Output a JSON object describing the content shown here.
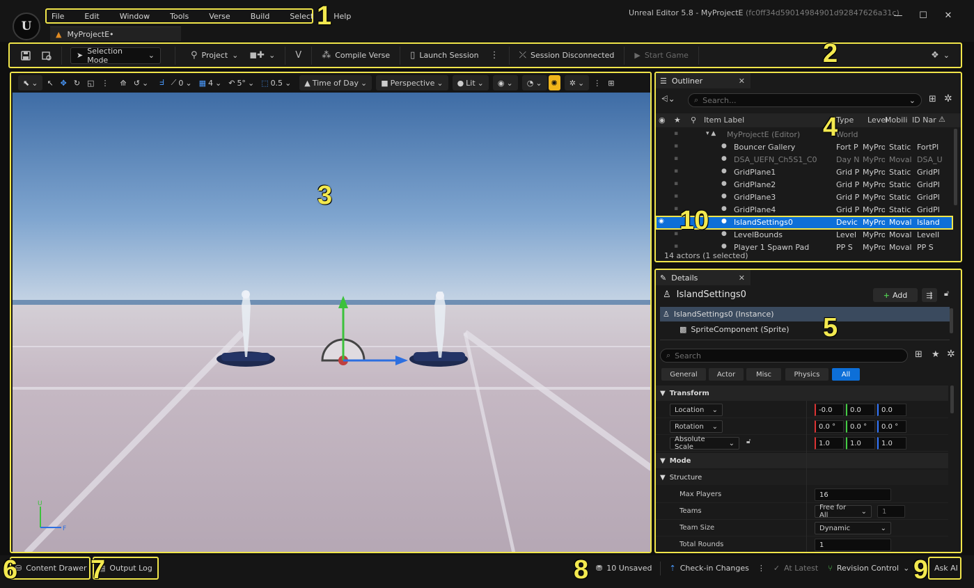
{
  "app": {
    "window_title": "Unreal Editor 5.8 - MyProjectE",
    "window_hash": "(fc0ff34d59014984901d92847626a31c)",
    "document_tab": "MyProjectE•"
  },
  "menu": [
    "File",
    "Edit",
    "Window",
    "Tools",
    "Verse",
    "Build",
    "Select",
    "Help"
  ],
  "toolbar": {
    "selection_mode": "Selection Mode",
    "project": "Project",
    "compile_verse": "Compile Verse",
    "launch_session": "Launch Session",
    "session_status": "Session Disconnected",
    "start_game": "Start Game"
  },
  "viewport": {
    "translate_snap": "0",
    "grid_snap": "4",
    "rotate_snap": "5°",
    "scale_snap": "0.5",
    "time_of_day": "Time of Day",
    "perspective": "Perspective",
    "view_mode": "Lit",
    "axis_x": "F",
    "axis_y": "U"
  },
  "outliner": {
    "tab_title": "Outliner",
    "search_placeholder": "Search...",
    "columns": {
      "label": "Item Label",
      "type": "Type",
      "level": "Level",
      "mobility": "Mobili",
      "id": "ID Nar"
    },
    "rows": [
      {
        "label": "MyProjectE (Editor)",
        "type": "World",
        "level": "",
        "mobility": "",
        "id": ""
      },
      {
        "label": "Bouncer Gallery",
        "type": "Fort P",
        "level": "MyPro",
        "mobility": "Static",
        "id": "FortPl"
      },
      {
        "label": "DSA_UEFN_Ch5S1_C0",
        "type": "Day N",
        "level": "MyPro",
        "mobility": "Moval",
        "id": "DSA_U"
      },
      {
        "label": "GridPlane1",
        "type": "Grid P",
        "level": "MyPro",
        "mobility": "Static",
        "id": "GridPl"
      },
      {
        "label": "GridPlane2",
        "type": "Grid P",
        "level": "MyPro",
        "mobility": "Static",
        "id": "GridPl"
      },
      {
        "label": "GridPlane3",
        "type": "Grid P",
        "level": "MyPro",
        "mobility": "Static",
        "id": "GridPl"
      },
      {
        "label": "GridPlane4",
        "type": "Grid P",
        "level": "MyPro",
        "mobility": "Static",
        "id": "GridPl"
      },
      {
        "label": "IslandSettings0",
        "type": "Devic",
        "level": "MyPro",
        "mobility": "Moval",
        "id": "Island"
      },
      {
        "label": "LevelBounds",
        "type": "Level",
        "level": "MyPro",
        "mobility": "Moval",
        "id": "LevelI"
      },
      {
        "label": "Player 1 Spawn Pad",
        "type": "PP S",
        "level": "MyPro",
        "mobility": "Moval",
        "id": "PP S"
      }
    ],
    "footer": "14 actors (1 selected)"
  },
  "details": {
    "tab_title": "Details",
    "actor_name": "IslandSettings0",
    "add_label": "Add",
    "components": [
      {
        "label": "IslandSettings0 (Instance)"
      },
      {
        "label": "SpriteComponent (Sprite)"
      }
    ],
    "search_placeholder": "Search",
    "filters": [
      "General",
      "Actor",
      "Misc",
      "Physics",
      "All"
    ],
    "transform_label": "Transform",
    "location_label": "Location",
    "rotation_label": "Rotation",
    "scale_label": "Absolute Scale",
    "location": [
      "-0.0",
      "0.0",
      "0.0"
    ],
    "rotation": [
      "0.0 °",
      "0.0 °",
      "0.0 °"
    ],
    "scale": [
      "1.0",
      "1.0",
      "1.0"
    ],
    "mode_label": "Mode",
    "structure_label": "Structure",
    "max_players_label": "Max Players",
    "max_players": "16",
    "teams_label": "Teams",
    "teams": "Free for All",
    "teams_count": "1",
    "team_size_label": "Team Size",
    "team_size": "Dynamic",
    "total_rounds_label": "Total Rounds",
    "total_rounds": "1"
  },
  "statusbar": {
    "content_drawer": "Content Drawer",
    "output_log": "Output Log",
    "unsaved": "10 Unsaved",
    "checkin": "Check-in Changes",
    "at_latest": "At Latest",
    "revision_control": "Revision Control",
    "ask_ai": "Ask AI"
  },
  "callouts": [
    "1",
    "2",
    "3",
    "4",
    "5",
    "6",
    "7",
    "8",
    "9",
    "10"
  ],
  "colors": {
    "highlight": "#f0e54a",
    "selection": "#0d6fd8",
    "accent_orange": "#f0b51b"
  }
}
